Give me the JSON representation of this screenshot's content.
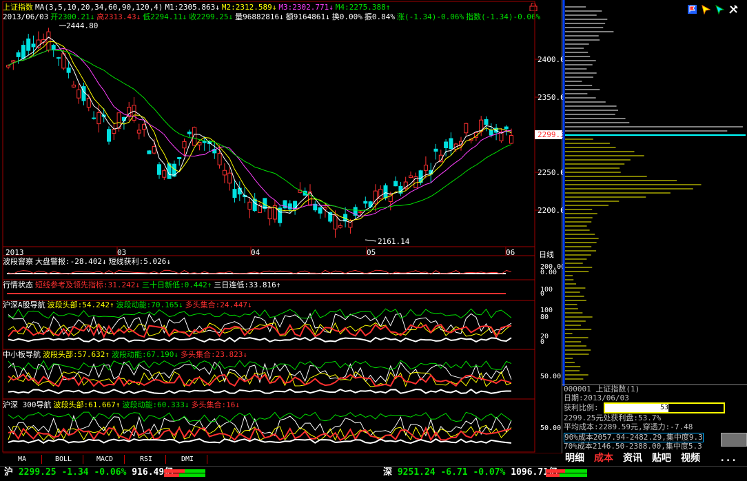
{
  "header": {
    "name": "上证指数",
    "ma_params": "MA(3,5,10,20,34,60,90,120,4)",
    "m1": "M1:2305.863↓",
    "m2": "M2:2312.589↓",
    "m3": "M3:2302.771↓",
    "m4": "M4:2275.388↑",
    "date": "2013/06/03",
    "open": "开2300.21↓",
    "high": "高2313.43↓",
    "low": "低2294.11↓",
    "close": "收2299.25↓",
    "volume": "量96882816↓",
    "amount": "额9164861↓",
    "turnover": "换0.00%",
    "amplitude": "振0.84%",
    "change": "涨(-1.34)-0.06%",
    "index_change": "指数(-1.34)-0.06%"
  },
  "main_chart": {
    "high_label": "2444.80",
    "low_label": "2161.14",
    "price_ticks": [
      "2400.0",
      "2350.0",
      "2300.0",
      "2250.0",
      "2200.0"
    ],
    "current_price": "2299.3",
    "month_labels": [
      "2013",
      "03",
      "04",
      "05",
      "06"
    ],
    "period": "日线"
  },
  "panels": [
    {
      "title": "波段窨察",
      "items": [
        {
          "text": "大盘警报:-28.402↓",
          "color": "#ffffff"
        },
        {
          "text": "短线获利:5.026↓",
          "color": "#ffffff"
        }
      ],
      "ticks": [
        "200.00",
        "0.00"
      ]
    },
    {
      "title": "行情状态",
      "items": [
        {
          "text": "短线参考及领先指标:31.242↓",
          "color": "#ff3030"
        },
        {
          "text": "三十日新低:0.442↑",
          "color": "#00e000"
        },
        {
          "text": "三日连低:33.816↑",
          "color": "#ffffff"
        }
      ],
      "ticks": [
        "100",
        "0"
      ]
    },
    {
      "title": "沪深A股导航",
      "items": [
        {
          "text": "波段头部:54.242↑",
          "color": "#ffff00"
        },
        {
          "text": "波段动能:70.165↓",
          "color": "#00e000"
        },
        {
          "text": "多头集合:24.447↓",
          "color": "#ff3030"
        }
      ],
      "ticks": [
        "100",
        "80",
        "20",
        "0"
      ]
    },
    {
      "title": "中小板导航",
      "items": [
        {
          "text": "波段头部:57.632↑",
          "color": "#ffff00"
        },
        {
          "text": "波段动能:67.190↓",
          "color": "#00e000"
        },
        {
          "text": "多头集合:23.823↓",
          "color": "#ff3030"
        }
      ],
      "ticks": [
        "50.00"
      ]
    },
    {
      "title": "沪深 300导航",
      "items": [
        {
          "text": "波段头部:61.667↑",
          "color": "#ffff00"
        },
        {
          "text": "波段动能:60.333↓",
          "color": "#00e000"
        },
        {
          "text": "多头集合:16↓",
          "color": "#ff3030"
        }
      ],
      "ticks": [
        "50.00"
      ]
    }
  ],
  "bottom_tabs": [
    "MA",
    "BOLL",
    "MACD",
    "RSI",
    "DMI"
  ],
  "cost_info": {
    "code_name": "000001 上证指数(1)",
    "date": "日期:2013/06/03",
    "profit_label": "获利比例:",
    "profit_value": "53.7%",
    "profit_pct": 53.7,
    "line1": "2299.25元处获利盘:53.7%",
    "line2": "平均成本:2289.59元,穿透力:-7.48",
    "line3": "90%成本2057.94-2482.29,集中度9.3",
    "line4": "70%成本2146.50-2388.00,集中度5.3"
  },
  "right_tabs": [
    "明细",
    "成本",
    "资讯",
    "贴吧",
    "视频",
    "..."
  ],
  "status": {
    "sh_label": "沪",
    "sh_price": "2299.25",
    "sh_change": "-1.34",
    "sh_pct": "-0.06%",
    "sh_amount": "916.49亿",
    "sz_label": "深",
    "sz_price": "9251.24",
    "sz_change": "-6.71",
    "sz_pct": "-0.07%",
    "sz_amount": "1096.71亿"
  },
  "colors": {
    "up": "#ff3030",
    "down": "#00e0e0",
    "grid": "#a00000",
    "ma3": "#ffffff",
    "ma5": "#ffff00",
    "ma10": "#ff40ff",
    "ma20": "#00e000"
  }
}
